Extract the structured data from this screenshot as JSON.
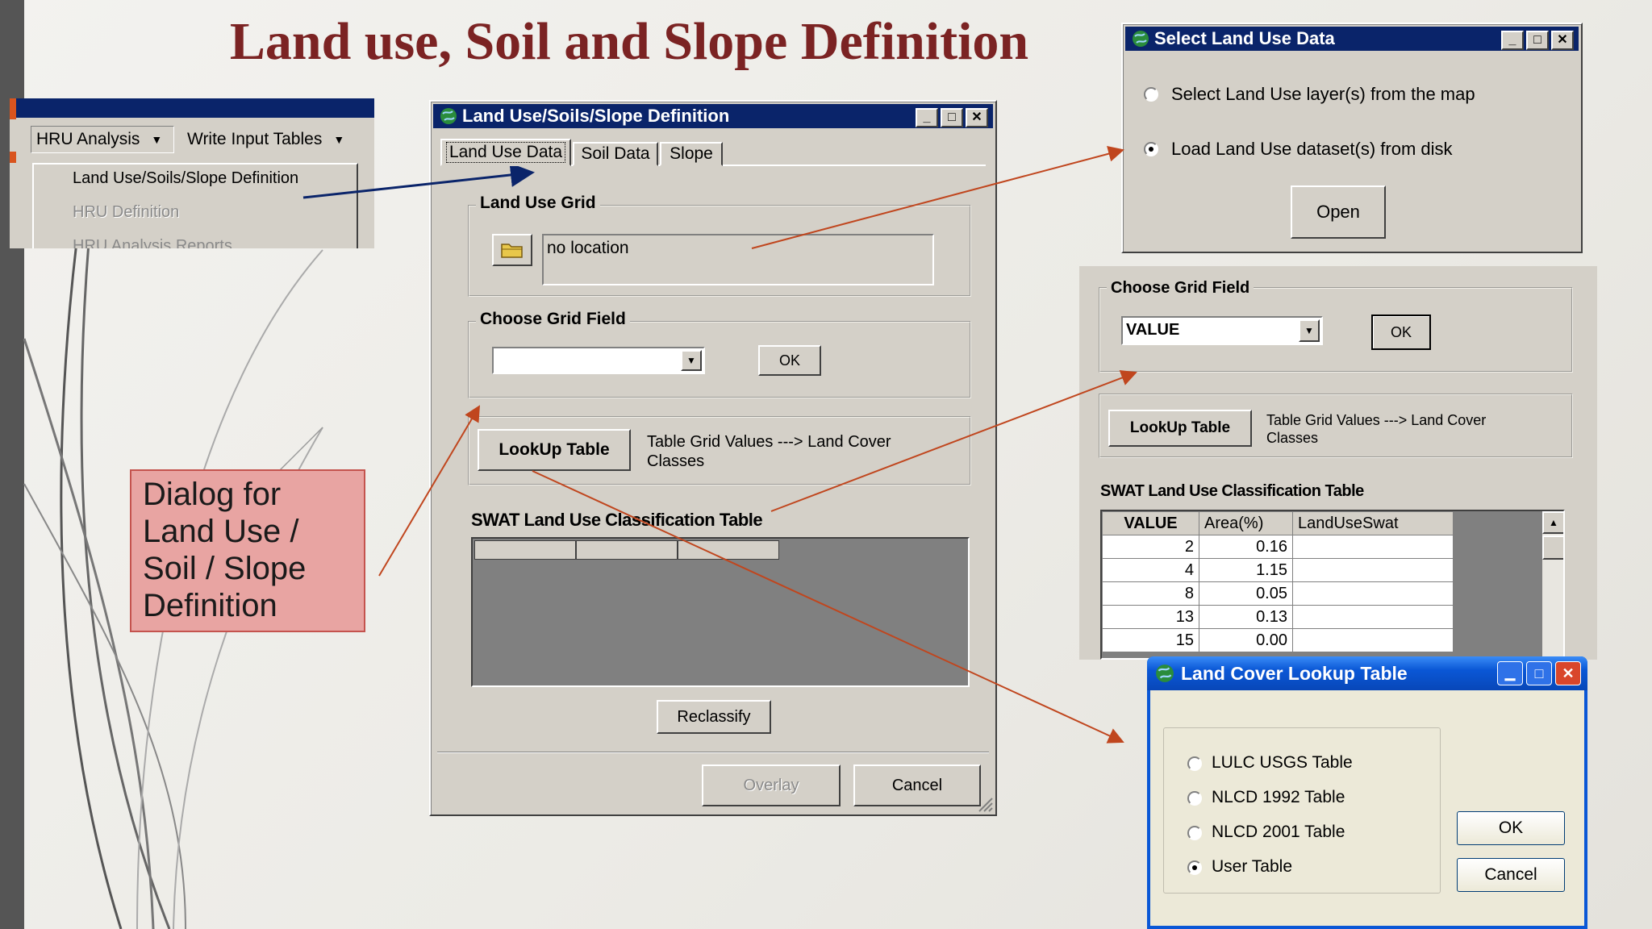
{
  "slide": {
    "title": "Land use, Soil and Slope Definition"
  },
  "menu": {
    "items": [
      "HRU Analysis",
      "Write Input Tables"
    ],
    "dropdown": [
      "Land Use/Soils/Slope Definition",
      "HRU Definition",
      "HRU Analysis Reports"
    ]
  },
  "main_dialog": {
    "title": "Land Use/Soils/Slope Definition",
    "tabs": [
      "Land Use Data",
      "Soil Data",
      "Slope"
    ],
    "grid_group": "Land Use Grid",
    "location_value": "no location",
    "field_group": "Choose Grid Field",
    "ok_label": "OK",
    "lookup_label": "LookUp Table",
    "lookup_desc": "Table Grid Values ---> Land Cover Classes",
    "swat_table_label": "SWAT Land Use Classification Table",
    "reclassify_label": "Reclassify",
    "overlay_label": "Overlay",
    "cancel_label": "Cancel"
  },
  "callout": {
    "text": "Dialog for Land Use / Soil / Slope Definition"
  },
  "select_dialog": {
    "title": "Select Land Use Data",
    "option_map": "Select Land Use layer(s) from the map",
    "option_disk": "Load Land Use dataset(s) from disk",
    "open_label": "Open",
    "selected": "disk"
  },
  "zoom_panel": {
    "field_group": "Choose Grid Field",
    "field_value": "VALUE",
    "ok_label": "OK",
    "lookup_label": "LookUp Table",
    "lookup_desc": "Table Grid Values ---> Land Cover Classes",
    "table_label": "SWAT Land Use Classification Table",
    "columns": [
      "VALUE",
      "Area(%)",
      "LandUseSwat"
    ],
    "rows": [
      [
        "2",
        "0.16",
        ""
      ],
      [
        "4",
        "1.15",
        ""
      ],
      [
        "8",
        "0.05",
        ""
      ],
      [
        "13",
        "0.13",
        ""
      ],
      [
        "15",
        "0.00",
        ""
      ]
    ]
  },
  "lookup_dialog": {
    "title": "Land Cover Lookup Table",
    "options": [
      "LULC USGS Table",
      "NLCD 1992 Table",
      "NLCD 2001 Table",
      "User Table"
    ],
    "selected_index": 3,
    "ok_label": "OK",
    "cancel_label": "Cancel"
  },
  "colors": {
    "title": "#7b2323",
    "titlebar": "#0a246a",
    "arrow": "#c0461e",
    "callout_bg": "#e8a4a2",
    "xp_titlebar": "#0a57d6"
  }
}
